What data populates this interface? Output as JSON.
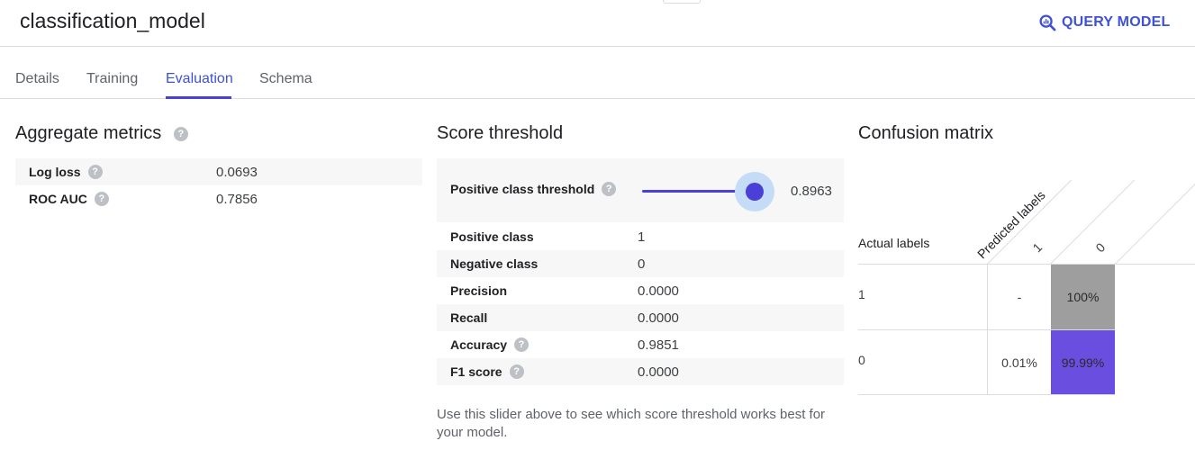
{
  "header": {
    "title": "classification_model",
    "query_button": "QUERY MODEL"
  },
  "tabs": [
    {
      "label": "Details"
    },
    {
      "label": "Training"
    },
    {
      "label": "Evaluation"
    },
    {
      "label": "Schema"
    }
  ],
  "active_tab": "Evaluation",
  "aggregate": {
    "title": "Aggregate metrics",
    "rows": [
      {
        "label": "Log loss",
        "value": "0.0693"
      },
      {
        "label": "ROC AUC",
        "value": "0.7856"
      }
    ]
  },
  "threshold": {
    "title": "Score threshold",
    "slider_label": "Positive class threshold",
    "slider_value": "0.8963",
    "rows": [
      {
        "label": "Positive class",
        "value": "1"
      },
      {
        "label": "Negative class",
        "value": "0"
      },
      {
        "label": "Precision",
        "value": "0.0000"
      },
      {
        "label": "Recall",
        "value": "0.0000"
      },
      {
        "label": "Accuracy",
        "value": "0.9851"
      },
      {
        "label": "F1 score",
        "value": "0.0000"
      }
    ],
    "note": "Use this slider above to see which score threshold works best for your model."
  },
  "confusion": {
    "title": "Confusion matrix",
    "predicted_label": "Predicted labels",
    "actual_label": "Actual labels",
    "predicted_classes": [
      "1",
      "0"
    ],
    "actual_classes": [
      "1",
      "0"
    ],
    "cells": [
      [
        "-",
        "100%"
      ],
      [
        "0.01%",
        "99.99%"
      ]
    ]
  },
  "colors": {
    "accent": "#3f51d6",
    "cell_gray": "#9e9e9e",
    "cell_purple": "#6a4ee0",
    "slider_halo": "#c5dcf7"
  }
}
